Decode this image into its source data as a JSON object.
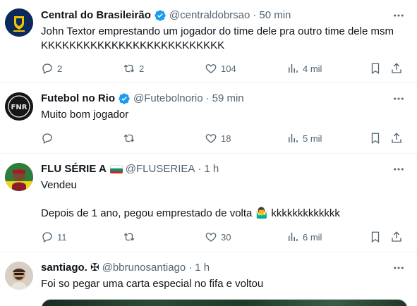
{
  "tweets": [
    {
      "name": "Central do Brasileirão",
      "handle": "@centraldobrsao",
      "sep": "·",
      "time": "50 min",
      "text": "John Textor emprestando um jogador do time dele pra outro time dele msm KKKKKKKKKKKKKKKKKKKKKKKKKK",
      "reply_count": "2",
      "retweet_count": "2",
      "like_count": "104",
      "views": "4 mil",
      "verified": true
    },
    {
      "name": "Futebol no Rio",
      "handle": "@Futebolnorio",
      "sep": "·",
      "time": "59 min",
      "text": "Muito bom jogador",
      "reply_count": "",
      "retweet_count": "",
      "like_count": "18",
      "views": "5 mil",
      "verified": true
    },
    {
      "name": "FLU SÉRIE A",
      "handle": "@FLUSERIEA",
      "sep": "·",
      "time": "1 h",
      "text": "Vendeu\n\nDepois de 1 ano, pegou emprestado de volta 🤷‍♂️ kkkkkkkkkkkkk",
      "reply_count": "11",
      "retweet_count": "",
      "like_count": "30",
      "views": "6 mil",
      "verified": false
    },
    {
      "name": "santiago. ✠",
      "handle": "@bbrunosantiago",
      "sep": "·",
      "time": "1 h",
      "text": "Foi so pegar uma carta especial no fifa e voltou",
      "verified": false
    }
  ],
  "colors": {
    "text_primary": "#0f1419",
    "text_secondary": "#536471",
    "verified_blue": "#1d9bf0",
    "divider": "#eff3f4"
  },
  "icons": [
    "more-icon",
    "verified-icon",
    "reply-icon",
    "retweet-icon",
    "like-icon",
    "views-icon",
    "bookmark-icon",
    "share-icon"
  ]
}
